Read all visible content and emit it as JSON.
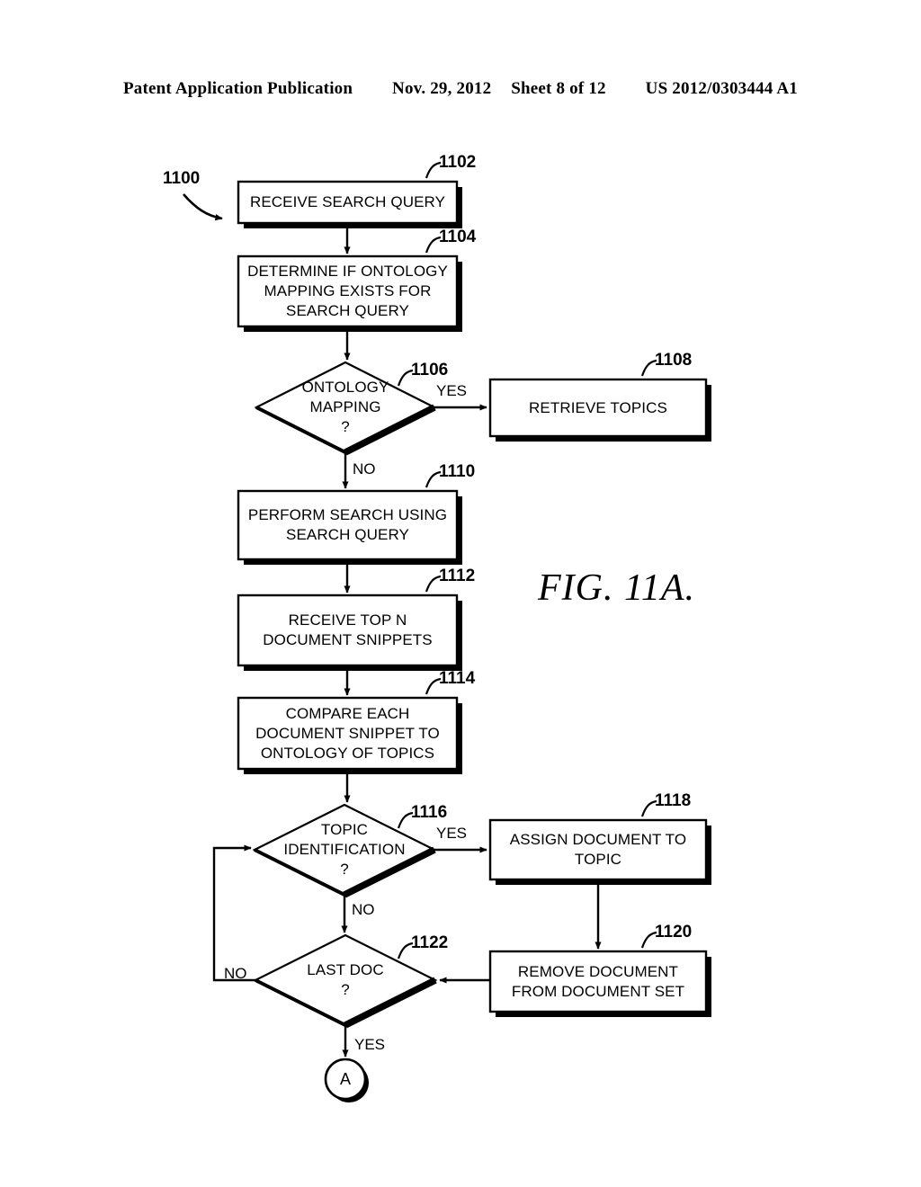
{
  "header": {
    "publication": "Patent Application Publication",
    "date": "Nov. 29, 2012",
    "sheet": "Sheet 8 of 12",
    "patent_number": "US 2012/0303444 A1"
  },
  "figure": {
    "caption": "FIG. 11A.",
    "flow_ref": "1100",
    "connector_letter": "A"
  },
  "nodes": {
    "n1102": {
      "ref": "1102",
      "lines": [
        "RECEIVE SEARCH QUERY"
      ]
    },
    "n1104": {
      "ref": "1104",
      "lines": [
        "DETERMINE IF ONTOLOGY",
        "MAPPING EXISTS FOR",
        "SEARCH QUERY"
      ]
    },
    "n1106": {
      "ref": "1106",
      "lines": [
        "ONTOLOGY",
        "MAPPING",
        "?"
      ]
    },
    "n1108": {
      "ref": "1108",
      "lines": [
        "RETRIEVE TOPICS"
      ]
    },
    "n1110": {
      "ref": "1110",
      "lines": [
        "PERFORM SEARCH USING",
        "SEARCH QUERY"
      ]
    },
    "n1112": {
      "ref": "1112",
      "lines": [
        "RECEIVE TOP N",
        "DOCUMENT SNIPPETS"
      ]
    },
    "n1114": {
      "ref": "1114",
      "lines": [
        "COMPARE EACH",
        "DOCUMENT SNIPPET TO",
        "ONTOLOGY OF TOPICS"
      ]
    },
    "n1116": {
      "ref": "1116",
      "lines": [
        "TOPIC",
        "IDENTIFICATION",
        "?"
      ]
    },
    "n1118": {
      "ref": "1118",
      "lines": [
        "ASSIGN DOCUMENT TO",
        "TOPIC"
      ]
    },
    "n1120": {
      "ref": "1120",
      "lines": [
        "REMOVE DOCUMENT",
        "FROM DOCUMENT SET"
      ]
    },
    "n1122": {
      "ref": "1122",
      "lines": [
        "LAST DOC",
        "?"
      ]
    }
  },
  "edge_labels": {
    "e1106_yes": "YES",
    "e1106_no": "NO",
    "e1116_yes": "YES",
    "e1116_no": "NO",
    "e1122_no": "NO",
    "e1122_yes": "YES"
  },
  "colors": {
    "ink": "#000000",
    "paper": "#ffffff"
  }
}
